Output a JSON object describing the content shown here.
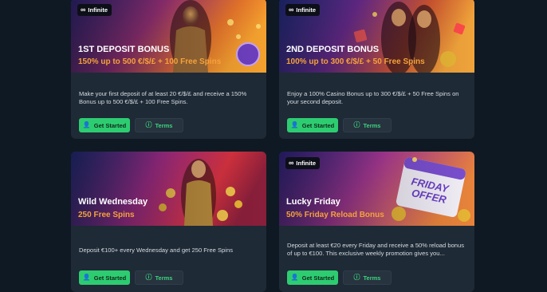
{
  "cards": [
    {
      "badge": "Infinite",
      "title": "1ST DEPOSIT BONUS",
      "subtitle": "150% up to 500 €/$/£ + 100 Free Spins",
      "description": "Make your first deposit of at least 20 €/$/£ and receive a 150% Bonus up to 500 €/$/£ + 100 Free Spins.",
      "primary_label": "Get Started",
      "secondary_label": "Terms"
    },
    {
      "badge": "Infinite",
      "title": "2ND DEPOSIT BONUS",
      "subtitle": "100% up to 300 €/$/£ + 50 Free Spins",
      "description": "Enjoy a 100% Casino Bonus up to 300 €/$/£ + 50 Free Spins on your second deposit.",
      "primary_label": "Get Started",
      "secondary_label": "Terms"
    },
    {
      "badge": "",
      "title": "Wild Wednesday",
      "subtitle": "250 Free Spins",
      "description": "Deposit €100+ every Wednesday and get 250 Free Spins",
      "primary_label": "Get Started",
      "secondary_label": "Terms"
    },
    {
      "badge": "Infinite",
      "title": "Lucky Friday",
      "subtitle": "50% Friday Reload Bonus",
      "description": "Deposit at least €20 every Friday and receive a 50% reload bonus of up to €100. This exclusive weekly promotion gives you...",
      "primary_label": "Get Started",
      "secondary_label": "Terms",
      "banner_art_text": "FRIDAY OFFER"
    }
  ],
  "colors": {
    "page_bg": "#0f1923",
    "card_bg": "#1e2a36",
    "accent_green": "#2ecc71",
    "subtitle_orange": "#f5a23b"
  },
  "icons": {
    "badge": "infinity-icon",
    "primary": "user-plus-icon",
    "secondary": "info-circle-icon"
  }
}
